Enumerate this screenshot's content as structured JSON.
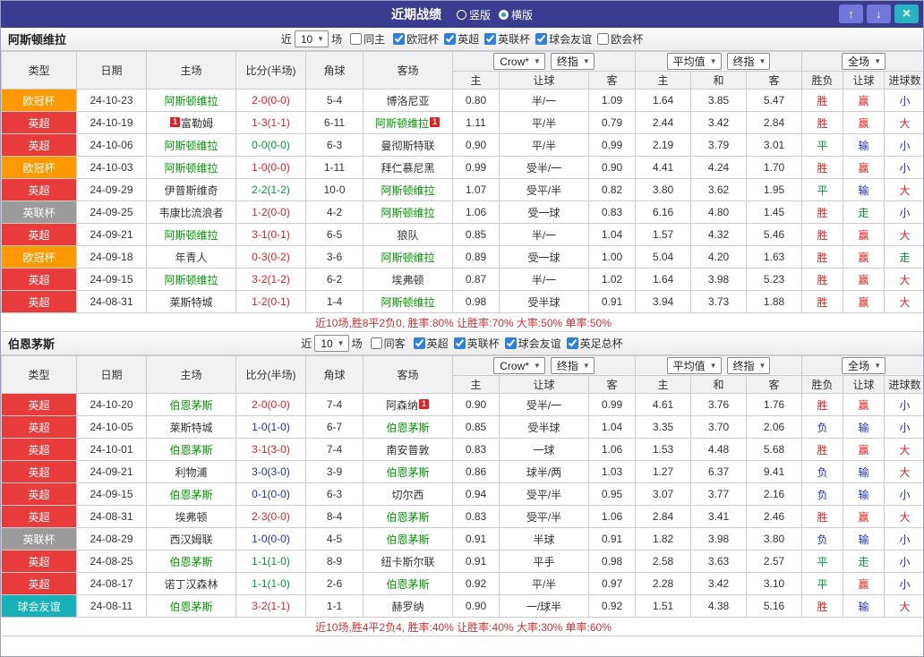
{
  "titlebar": {
    "title": "近期战绩",
    "layout_options": [
      "竖版",
      "横版"
    ],
    "selected_layout": "横版",
    "up_icon": "↑",
    "down_icon": "↓",
    "close_icon": "×"
  },
  "colors": {
    "win": "#e02222",
    "draw": "#009933",
    "loss": "#2030cc",
    "focal_team": "#009900",
    "summary_text": "#d03030",
    "titlebar_bg": "#3a3d8f",
    "type_colors": {
      "欧冠杯": "#ff9900",
      "英超": "#e83b3b",
      "英联杯": "#9b9b9b",
      "球会友谊": "#17b1ba"
    },
    "outcome_map": {
      "胜": "win",
      "平": "draw",
      "负": "loss",
      "赢": "win",
      "走": "draw",
      "输": "loss",
      "大": "win",
      "小": "loss"
    }
  },
  "table_headers": {
    "cols": [
      "类型",
      "日期",
      "主场",
      "比分(半场)",
      "角球",
      "客场"
    ],
    "sub": [
      "主",
      "让球",
      "客",
      "主",
      "和",
      "客",
      "胜负",
      "让球",
      "进球数"
    ]
  },
  "sections": [
    {
      "team": "阿斯顿维拉",
      "filter": {
        "near": "近",
        "count": "10",
        "games": "场",
        "same": "同主",
        "same_checked": false,
        "leagues": [
          {
            "label": "欧冠杯",
            "checked": true
          },
          {
            "label": "英超",
            "checked": true
          },
          {
            "label": "英联杯",
            "checked": true
          },
          {
            "label": "球会友谊",
            "checked": true
          },
          {
            "label": "欧会杯",
            "checked": false
          }
        ]
      },
      "dropdowns": {
        "bookmaker": "Crow*",
        "odds_time": "终指",
        "avg_source": "平均值",
        "avg_time": "终指",
        "scope": "全场"
      },
      "rows": [
        {
          "type": "欧冠杯",
          "date": "24-10-23",
          "home": "阿斯顿维拉",
          "home_focal": true,
          "home_badge": "",
          "score": "2-0(0-0)",
          "corner": "5-4",
          "away": "博洛尼亚",
          "away_focal": false,
          "away_badge": "",
          "odds": [
            "0.80",
            "半/一",
            "1.09"
          ],
          "avg": [
            "1.64",
            "3.85",
            "5.47"
          ],
          "result": "胜",
          "handicap": "赢",
          "goals": "小"
        },
        {
          "type": "英超",
          "date": "24-10-19",
          "home": "富勒姆",
          "home_focal": false,
          "home_badge": "1",
          "score": "1-3(1-1)",
          "corner": "6-11",
          "away": "阿斯顿维拉",
          "away_focal": true,
          "away_badge": "1",
          "odds": [
            "1.11",
            "平/半",
            "0.79"
          ],
          "avg": [
            "2.44",
            "3.42",
            "2.84"
          ],
          "result": "胜",
          "handicap": "赢",
          "goals": "大"
        },
        {
          "type": "英超",
          "date": "24-10-06",
          "home": "阿斯顿维拉",
          "home_focal": true,
          "home_badge": "",
          "score": "0-0(0-0)",
          "corner": "6-3",
          "away": "曼彻斯特联",
          "away_focal": false,
          "away_badge": "",
          "odds": [
            "0.90",
            "平/半",
            "0.99"
          ],
          "avg": [
            "2.19",
            "3.79",
            "3.01"
          ],
          "result": "平",
          "handicap": "输",
          "goals": "小"
        },
        {
          "type": "欧冠杯",
          "date": "24-10-03",
          "home": "阿斯顿维拉",
          "home_focal": true,
          "home_badge": "",
          "score": "1-0(0-0)",
          "corner": "1-11",
          "away": "拜仁慕尼黑",
          "away_focal": false,
          "away_badge": "",
          "odds": [
            "0.99",
            "受半/一",
            "0.90"
          ],
          "avg": [
            "4.41",
            "4.24",
            "1.70"
          ],
          "result": "胜",
          "handicap": "赢",
          "goals": "小"
        },
        {
          "type": "英超",
          "date": "24-09-29",
          "home": "伊普斯维奇",
          "home_focal": false,
          "home_badge": "",
          "score": "2-2(1-2)",
          "corner": "10-0",
          "away": "阿斯顿维拉",
          "away_focal": true,
          "away_badge": "",
          "odds": [
            "1.07",
            "受平/半",
            "0.82"
          ],
          "avg": [
            "3.80",
            "3.62",
            "1.95"
          ],
          "result": "平",
          "handicap": "输",
          "goals": "大"
        },
        {
          "type": "英联杯",
          "date": "24-09-25",
          "home": "韦康比流浪者",
          "home_focal": false,
          "home_badge": "",
          "score": "1-2(0-0)",
          "corner": "4-2",
          "away": "阿斯顿维拉",
          "away_focal": true,
          "away_badge": "",
          "odds": [
            "1.06",
            "受一球",
            "0.83"
          ],
          "avg": [
            "6.16",
            "4.80",
            "1.45"
          ],
          "result": "胜",
          "handicap": "走",
          "goals": "小"
        },
        {
          "type": "英超",
          "date": "24-09-21",
          "home": "阿斯顿维拉",
          "home_focal": true,
          "home_badge": "",
          "score": "3-1(0-1)",
          "corner": "6-5",
          "away": "狼队",
          "away_focal": false,
          "away_badge": "",
          "odds": [
            "0.85",
            "半/一",
            "1.04"
          ],
          "avg": [
            "1.57",
            "4.32",
            "5.46"
          ],
          "result": "胜",
          "handicap": "赢",
          "goals": "大"
        },
        {
          "type": "欧冠杯",
          "date": "24-09-18",
          "home": "年青人",
          "home_focal": false,
          "home_badge": "",
          "score": "0-3(0-2)",
          "corner": "3-6",
          "away": "阿斯顿维拉",
          "away_focal": true,
          "away_badge": "",
          "odds": [
            "0.89",
            "受一球",
            "1.00"
          ],
          "avg": [
            "5.04",
            "4.20",
            "1.63"
          ],
          "result": "胜",
          "handicap": "赢",
          "goals": "走"
        },
        {
          "type": "英超",
          "date": "24-09-15",
          "home": "阿斯顿维拉",
          "home_focal": true,
          "home_badge": "",
          "score": "3-2(1-2)",
          "corner": "6-2",
          "away": "埃弗顿",
          "away_focal": false,
          "away_badge": "",
          "odds": [
            "0.87",
            "半/一",
            "1.02"
          ],
          "avg": [
            "1.64",
            "3.98",
            "5.23"
          ],
          "result": "胜",
          "handicap": "赢",
          "goals": "大"
        },
        {
          "type": "英超",
          "date": "24-08-31",
          "home": "莱斯特城",
          "home_focal": false,
          "home_badge": "",
          "score": "1-2(0-1)",
          "corner": "1-4",
          "away": "阿斯顿维拉",
          "away_focal": true,
          "away_badge": "",
          "odds": [
            "0.98",
            "受半球",
            "0.91"
          ],
          "avg": [
            "3.94",
            "3.73",
            "1.88"
          ],
          "result": "胜",
          "handicap": "赢",
          "goals": "大"
        }
      ],
      "summary": "近10场,胜8平2负0, 胜率:80% 让胜率:70% 大率:50% 单率:50%"
    },
    {
      "team": "伯恩茅斯",
      "filter": {
        "near": "近",
        "count": "10",
        "games": "场",
        "same": "同客",
        "same_checked": false,
        "leagues": [
          {
            "label": "英超",
            "checked": true
          },
          {
            "label": "英联杯",
            "checked": true
          },
          {
            "label": "球会友谊",
            "checked": true
          },
          {
            "label": "英足总杯",
            "checked": true
          }
        ]
      },
      "dropdowns": {
        "bookmaker": "Crow*",
        "odds_time": "终指",
        "avg_source": "平均值",
        "avg_time": "终指",
        "scope": "全场"
      },
      "rows": [
        {
          "type": "英超",
          "date": "24-10-20",
          "home": "伯恩茅斯",
          "home_focal": true,
          "home_badge": "",
          "score": "2-0(0-0)",
          "corner": "7-4",
          "away": "阿森纳",
          "away_focal": false,
          "away_badge": "1",
          "odds": [
            "0.90",
            "受半/一",
            "0.99"
          ],
          "avg": [
            "4.61",
            "3.76",
            "1.76"
          ],
          "result": "胜",
          "handicap": "赢",
          "goals": "小"
        },
        {
          "type": "英超",
          "date": "24-10-05",
          "home": "莱斯特城",
          "home_focal": false,
          "home_badge": "",
          "score": "1-0(1-0)",
          "corner": "6-7",
          "away": "伯恩茅斯",
          "away_focal": true,
          "away_badge": "",
          "odds": [
            "0.85",
            "受半球",
            "1.04"
          ],
          "avg": [
            "3.35",
            "3.70",
            "2.06"
          ],
          "result": "负",
          "handicap": "输",
          "goals": "小"
        },
        {
          "type": "英超",
          "date": "24-10-01",
          "home": "伯恩茅斯",
          "home_focal": true,
          "home_badge": "",
          "score": "3-1(3-0)",
          "corner": "7-4",
          "away": "南安普敦",
          "away_focal": false,
          "away_badge": "",
          "odds": [
            "0.83",
            "一球",
            "1.06"
          ],
          "avg": [
            "1.53",
            "4.48",
            "5.68"
          ],
          "result": "胜",
          "handicap": "赢",
          "goals": "大"
        },
        {
          "type": "英超",
          "date": "24-09-21",
          "home": "利物浦",
          "home_focal": false,
          "home_badge": "",
          "score": "3-0(3-0)",
          "corner": "3-9",
          "away": "伯恩茅斯",
          "away_focal": true,
          "away_badge": "",
          "odds": [
            "0.86",
            "球半/两",
            "1.03"
          ],
          "avg": [
            "1.27",
            "6.37",
            "9.41"
          ],
          "result": "负",
          "handicap": "输",
          "goals": "大"
        },
        {
          "type": "英超",
          "date": "24-09-15",
          "home": "伯恩茅斯",
          "home_focal": true,
          "home_badge": "",
          "score": "0-1(0-0)",
          "corner": "6-3",
          "away": "切尔西",
          "away_focal": false,
          "away_badge": "",
          "odds": [
            "0.94",
            "受平/半",
            "0.95"
          ],
          "avg": [
            "3.07",
            "3.77",
            "2.16"
          ],
          "result": "负",
          "handicap": "输",
          "goals": "小"
        },
        {
          "type": "英超",
          "date": "24-08-31",
          "home": "埃弗顿",
          "home_focal": false,
          "home_badge": "",
          "score": "2-3(0-0)",
          "corner": "8-4",
          "away": "伯恩茅斯",
          "away_focal": true,
          "away_badge": "",
          "odds": [
            "0.83",
            "受平/半",
            "1.06"
          ],
          "avg": [
            "2.84",
            "3.41",
            "2.46"
          ],
          "result": "胜",
          "handicap": "赢",
          "goals": "大"
        },
        {
          "type": "英联杯",
          "date": "24-08-29",
          "home": "西汉姆联",
          "home_focal": false,
          "home_badge": "",
          "score": "1-0(0-0)",
          "corner": "4-5",
          "away": "伯恩茅斯",
          "away_focal": true,
          "away_badge": "",
          "odds": [
            "0.91",
            "半球",
            "0.91"
          ],
          "avg": [
            "1.82",
            "3.98",
            "3.80"
          ],
          "result": "负",
          "handicap": "输",
          "goals": "小"
        },
        {
          "type": "英超",
          "date": "24-08-25",
          "home": "伯恩茅斯",
          "home_focal": true,
          "home_badge": "",
          "score": "1-1(1-0)",
          "corner": "8-9",
          "away": "纽卡斯尔联",
          "away_focal": false,
          "away_badge": "",
          "odds": [
            "0.91",
            "平手",
            "0.98"
          ],
          "avg": [
            "2.58",
            "3.63",
            "2.57"
          ],
          "result": "平",
          "handicap": "走",
          "goals": "小"
        },
        {
          "type": "英超",
          "date": "24-08-17",
          "home": "诺丁汉森林",
          "home_focal": false,
          "home_badge": "",
          "score": "1-1(1-0)",
          "corner": "2-6",
          "away": "伯恩茅斯",
          "away_focal": true,
          "away_badge": "",
          "odds": [
            "0.92",
            "平/半",
            "0.97"
          ],
          "avg": [
            "2.28",
            "3.42",
            "3.10"
          ],
          "result": "平",
          "handicap": "赢",
          "goals": "小"
        },
        {
          "type": "球会友谊",
          "date": "24-08-11",
          "home": "伯恩茅斯",
          "home_focal": true,
          "home_badge": "",
          "score": "3-2(1-1)",
          "corner": "1-1",
          "away": "赫罗纳",
          "away_focal": false,
          "away_badge": "",
          "odds": [
            "0.90",
            "一/球半",
            "0.92"
          ],
          "avg": [
            "1.51",
            "4.38",
            "5.16"
          ],
          "result": "胜",
          "handicap": "输",
          "goals": "大"
        }
      ],
      "summary": "近10场,胜4平2负4, 胜率:40% 让胜率:40% 大率:30% 单率:60%"
    }
  ]
}
